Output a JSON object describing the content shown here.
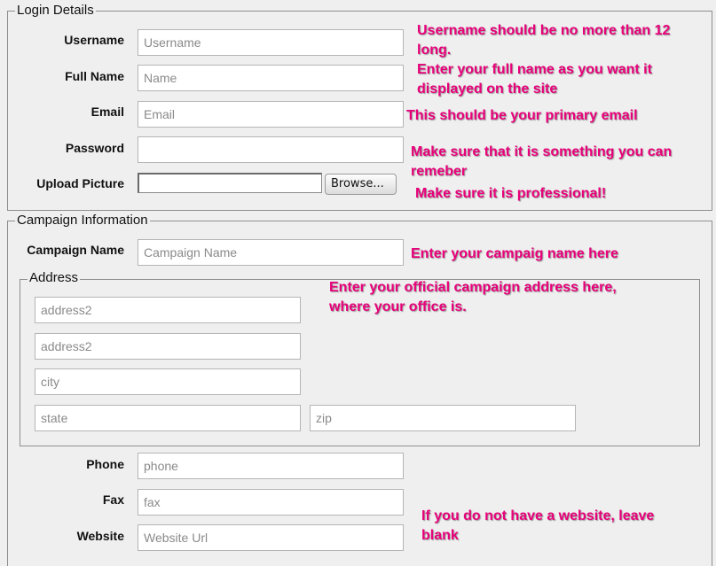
{
  "login": {
    "legend": "Login Details",
    "username": {
      "label": "Username",
      "placeholder": "Username"
    },
    "fullname": {
      "label": "Full Name",
      "placeholder": "Name"
    },
    "email": {
      "label": "Email",
      "placeholder": "Email"
    },
    "password": {
      "label": "Password",
      "placeholder": ""
    },
    "picture": {
      "label": "Upload Picture",
      "button": "Browse..."
    }
  },
  "campaign": {
    "legend": "Campaign Information",
    "name": {
      "label": "Campaign Name",
      "placeholder": "Campaign Name"
    },
    "address": {
      "legend": "Address",
      "line1_placeholder": "address2",
      "line2_placeholder": "address2",
      "city_placeholder": "city",
      "state_placeholder": "state",
      "zip_placeholder": "zip"
    },
    "phone": {
      "label": "Phone",
      "placeholder": "phone"
    },
    "fax": {
      "label": "Fax",
      "placeholder": "fax"
    },
    "website": {
      "label": "Website",
      "placeholder": "Website Url"
    }
  },
  "notes": {
    "username_a": "Username should be no more than 12",
    "username_b": "long.",
    "fullname_a": "Enter your full name as you want it",
    "fullname_b": "displayed on the site",
    "email": "This should be your primary email",
    "password_a": "Make sure that it is something you can",
    "password_b": "remeber",
    "picture": "Make sure it is professional!",
    "campaign": "Enter your campaig name here",
    "address_a": "Enter your official campaign address here,",
    "address_b": "where your office is.",
    "website_a": "If you do not have a website, leave",
    "website_b": "blank"
  },
  "colors": {
    "annotation": "#e8007a",
    "background": "#efefef"
  }
}
